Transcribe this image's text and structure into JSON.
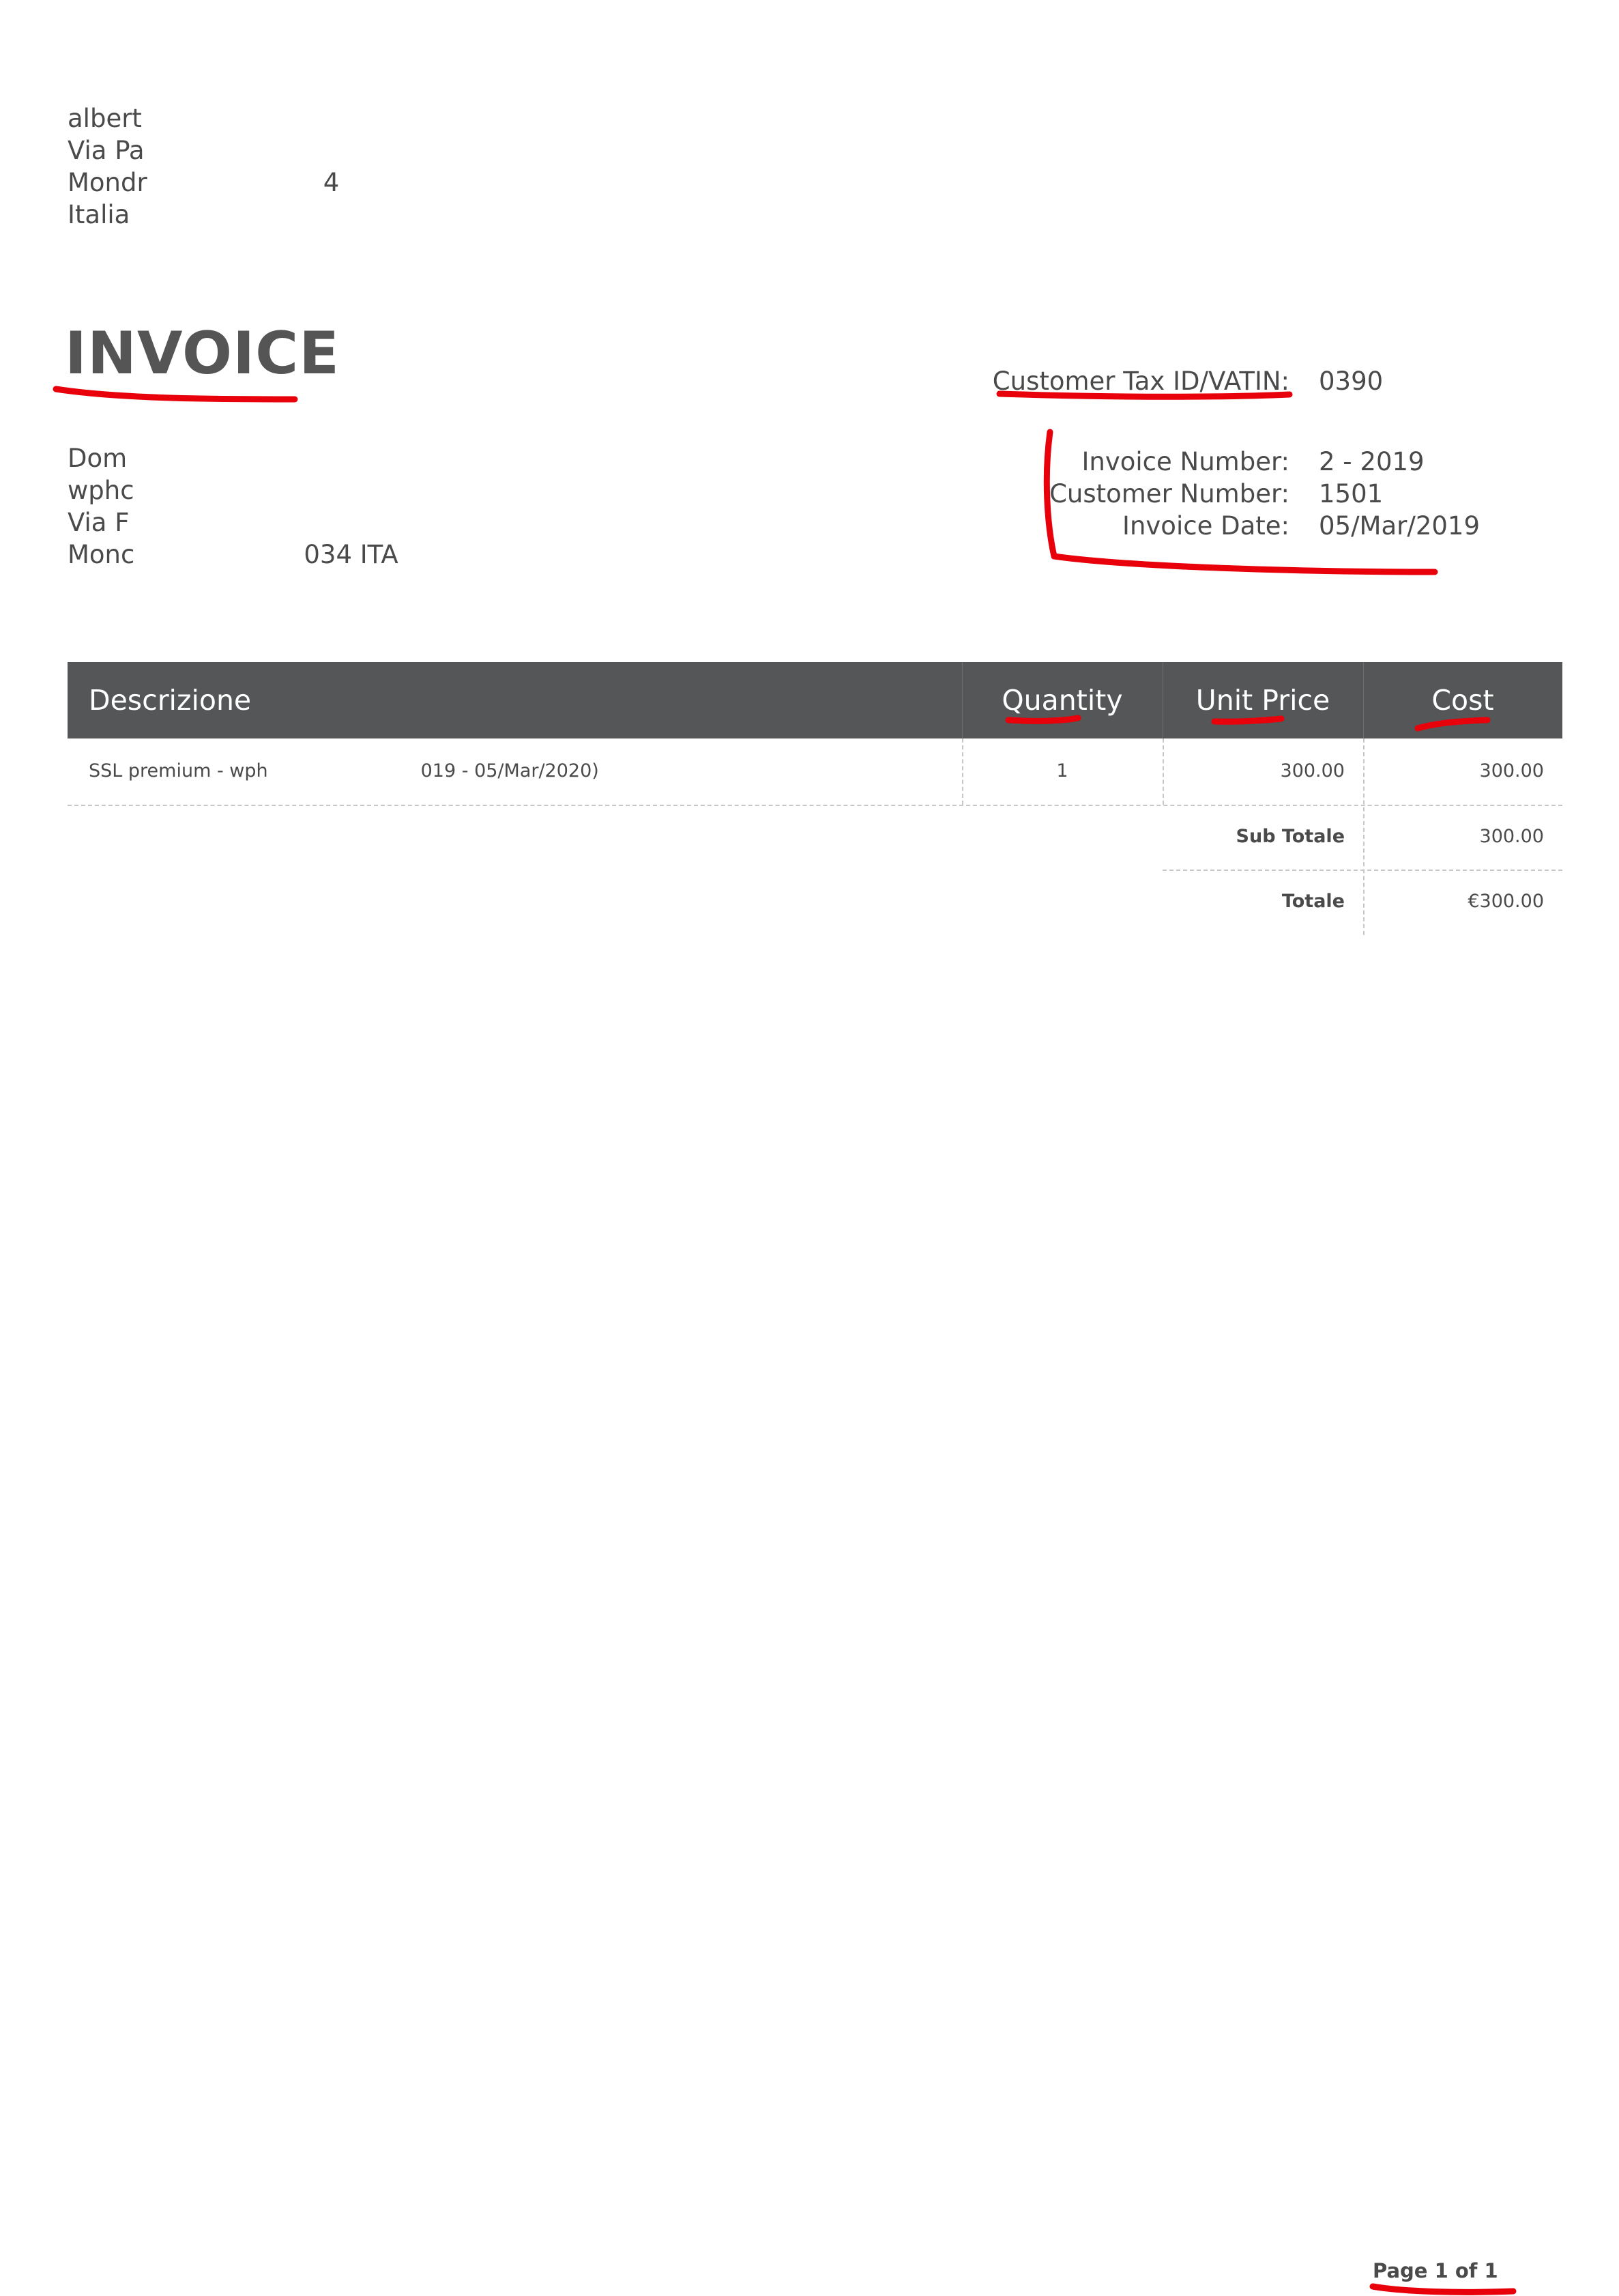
{
  "sender": {
    "lines": [
      "albert",
      "Via Pa",
      "Mondr",
      "Italia"
    ],
    "line3_tail": "4"
  },
  "title": "INVOICE",
  "customer": {
    "lines": [
      "Dom",
      "wphc",
      "Via F",
      "Monc"
    ],
    "line4_tail": "034 ITA"
  },
  "meta": {
    "tax_label": "Customer Tax ID/VATIN:",
    "tax_value": "0390",
    "invoice_number_label": "Invoice Number:",
    "invoice_number_value": "2 - 2019",
    "customer_number_label": "Customer Number:",
    "customer_number_value": "1501",
    "invoice_date_label": "Invoice Date:",
    "invoice_date_value": "05/Mar/2019"
  },
  "table": {
    "headers": {
      "description": "Descrizione",
      "quantity": "Quantity",
      "unit_price": "Unit Price",
      "cost": "Cost"
    },
    "rows": [
      {
        "description_head": "SSL premium - wph",
        "description_tail": "019 - 05/Mar/2020)",
        "quantity": "1",
        "unit_price": "300.00",
        "cost": "300.00"
      }
    ],
    "subtotal_label": "Sub Totale",
    "subtotal_value": "300.00",
    "total_label": "Totale",
    "total_value": "€300.00"
  },
  "footer": {
    "page": "Page 1 of 1"
  },
  "colors": {
    "header_bg": "#555657",
    "annotation": "#e8000b",
    "text": "#4a4a4a"
  }
}
